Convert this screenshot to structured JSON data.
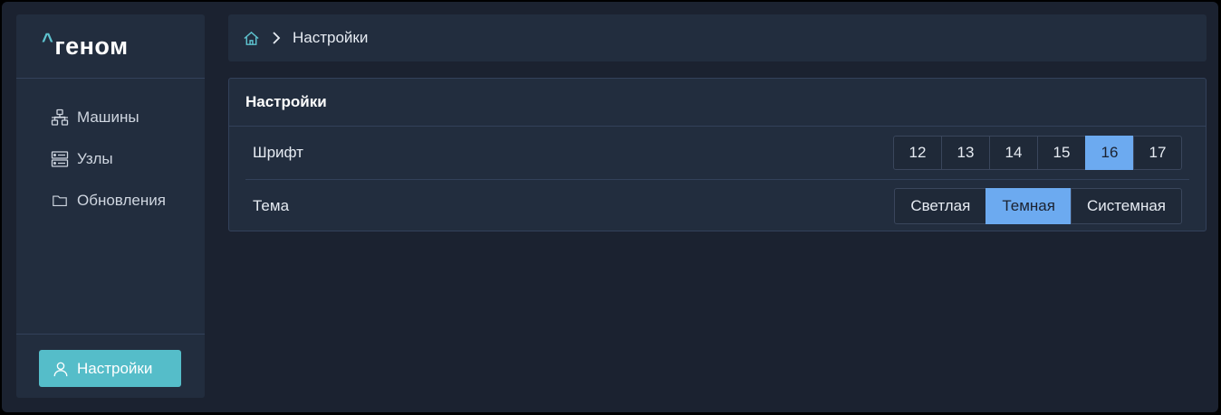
{
  "app": {
    "logo_caret": "^",
    "logo_text": "геном"
  },
  "sidebar": {
    "items": [
      {
        "label": "Машины",
        "icon": "network-icon"
      },
      {
        "label": "Узлы",
        "icon": "server-icon"
      },
      {
        "label": "Обновления",
        "icon": "folder-icon"
      }
    ],
    "settings_button": {
      "label": "Настройки",
      "icon": "user-icon"
    }
  },
  "breadcrumb": {
    "home_icon": "home-icon",
    "current": "Настройки"
  },
  "panel": {
    "title": "Настройки",
    "font": {
      "label": "Шрифт",
      "options": [
        "12",
        "13",
        "14",
        "15",
        "16",
        "17"
      ],
      "selected": "16"
    },
    "theme": {
      "label": "Тема",
      "options": [
        "Светлая",
        "Темная",
        "Системная"
      ],
      "selected": "Темная"
    }
  },
  "colors": {
    "accent": "#55bdc9",
    "selected": "#6caaf0",
    "background": "#1b2230",
    "surface": "#222d3e"
  }
}
